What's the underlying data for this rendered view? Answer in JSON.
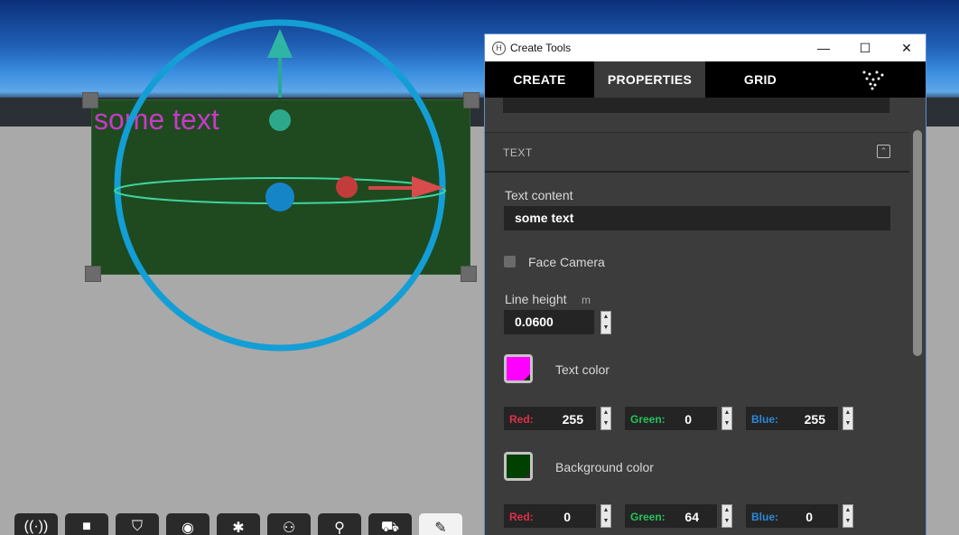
{
  "scene": {
    "panel_text": "some text",
    "colors": {
      "panel_bg": "#1f4a1f",
      "panel_text": "#c83ac8",
      "gizmo_ring": "#139ed6"
    }
  },
  "toolbar": {
    "buttons": [
      {
        "name": "audio-tool-icon",
        "glyph": "((·))"
      },
      {
        "name": "chat-tool-icon",
        "glyph": "■"
      },
      {
        "name": "shield-tool-icon",
        "glyph": "⛉"
      },
      {
        "name": "camera-tool-icon",
        "glyph": "◉"
      },
      {
        "name": "avatar-tool-icon",
        "glyph": "✱"
      },
      {
        "name": "people-tool-icon",
        "glyph": "⚇"
      },
      {
        "name": "search-tool-icon",
        "glyph": "⚲"
      },
      {
        "name": "cart-tool-icon",
        "glyph": "⛟"
      },
      {
        "name": "create-tool-icon",
        "glyph": "✎"
      }
    ]
  },
  "window": {
    "title": "Create Tools",
    "controls": {
      "minimize": "—",
      "maximize": "☐",
      "close": "✕"
    },
    "tabs": [
      {
        "label": "CREATE"
      },
      {
        "label": "PROPERTIES"
      },
      {
        "label": "GRID"
      }
    ]
  },
  "text_section": {
    "title": "TEXT",
    "collapse_glyph": "⌃",
    "text_content_label": "Text content",
    "text_content_value": "some text",
    "face_camera_label": "Face Camera",
    "face_camera_checked": false,
    "line_height_label": "Line height",
    "line_height_unit": "m",
    "line_height_value": "0.0600",
    "text_color": {
      "label": "Text color",
      "swatch": "#ff00ff",
      "red_label": "Red:",
      "red": "255",
      "green_label": "Green:",
      "green": "0",
      "blue_label": "Blue:",
      "blue": "255"
    },
    "background_color": {
      "label": "Background color",
      "swatch": "#004000",
      "red_label": "Red:",
      "red": "0",
      "green_label": "Green:",
      "green": "64",
      "blue_label": "Blue:",
      "blue": "0"
    },
    "colors": {
      "red_label": "#e0304a",
      "green_label": "#27c25c",
      "blue_label": "#2a8ad8"
    }
  }
}
